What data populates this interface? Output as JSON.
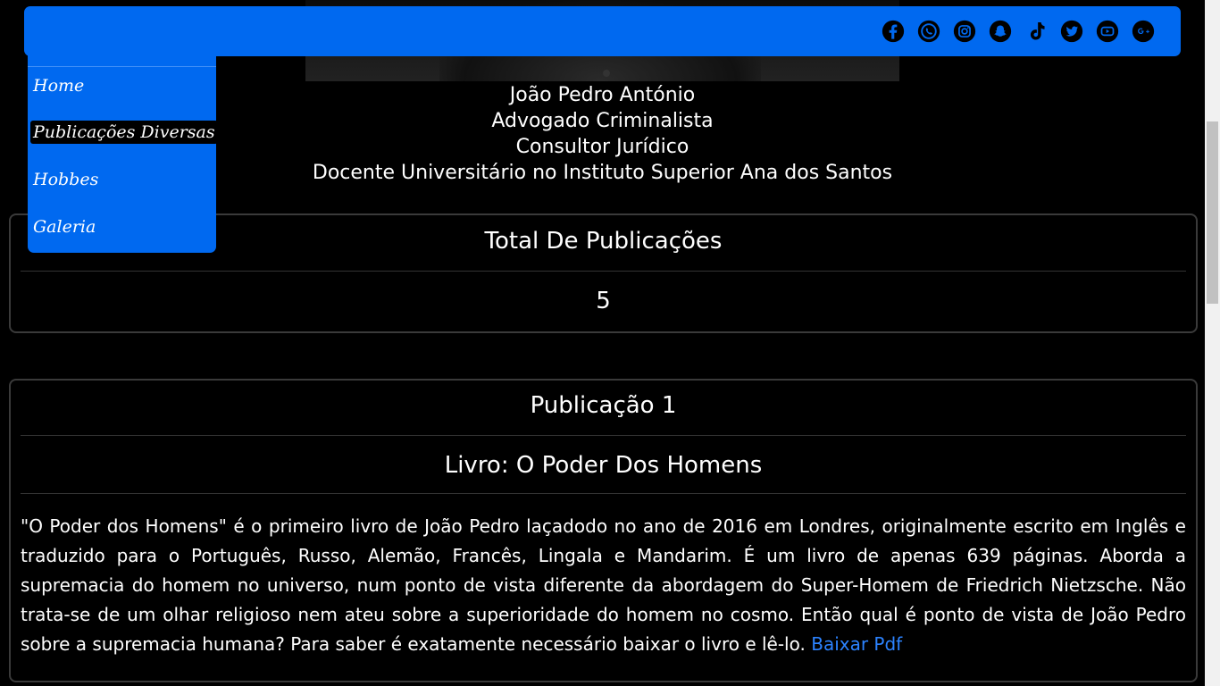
{
  "profile": {
    "name": "João Pedro António",
    "role1": "Advogado Criminalista",
    "role2": "Consultor Jurídico",
    "role3": "Docente Universitário no Instituto Superior Ana dos Santos"
  },
  "menu": {
    "items": [
      {
        "label": "Home"
      },
      {
        "label": "Publicações Diversas"
      },
      {
        "label": "Hobbes"
      },
      {
        "label": "Galeria"
      }
    ],
    "active": "Publicações Diversas"
  },
  "social": [
    "facebook-icon",
    "whatsapp-icon",
    "instagram-icon",
    "snapchat-icon",
    "tiktok-icon",
    "twitter-icon",
    "youtube-icon",
    "google-plus-icon"
  ],
  "summary": {
    "title": "Total De Publicações",
    "count": "5"
  },
  "publication": {
    "title": "Publicação 1",
    "subtitle": "Livro: O Poder Dos Homens",
    "description": "\"O Poder dos Homens\" é o primeiro livro de João Pedro laçadodo no ano de 2016 em Londres, originalmente escrito em Inglês e traduzido para o Português, Russo, Alemão, Francês, Lingala e Mandarim. É um livro de apenas 639 páginas. Aborda a supremacia do homem no universo, num ponto de vista diferente da abordagem do Super-Homem de Friedrich Nietzsche. Não trata-se de um olhar religioso nem ateu sobre a superioridade do homem no cosmo. Então qual é ponto de vista de João Pedro sobre a supremacia humana? Para saber é exatamente necessário baixar o livro e lê-lo.",
    "link_label": "Baixar Pdf"
  },
  "colors": {
    "accent": "#0069f0",
    "link": "#2c83ff",
    "background": "#000000"
  }
}
